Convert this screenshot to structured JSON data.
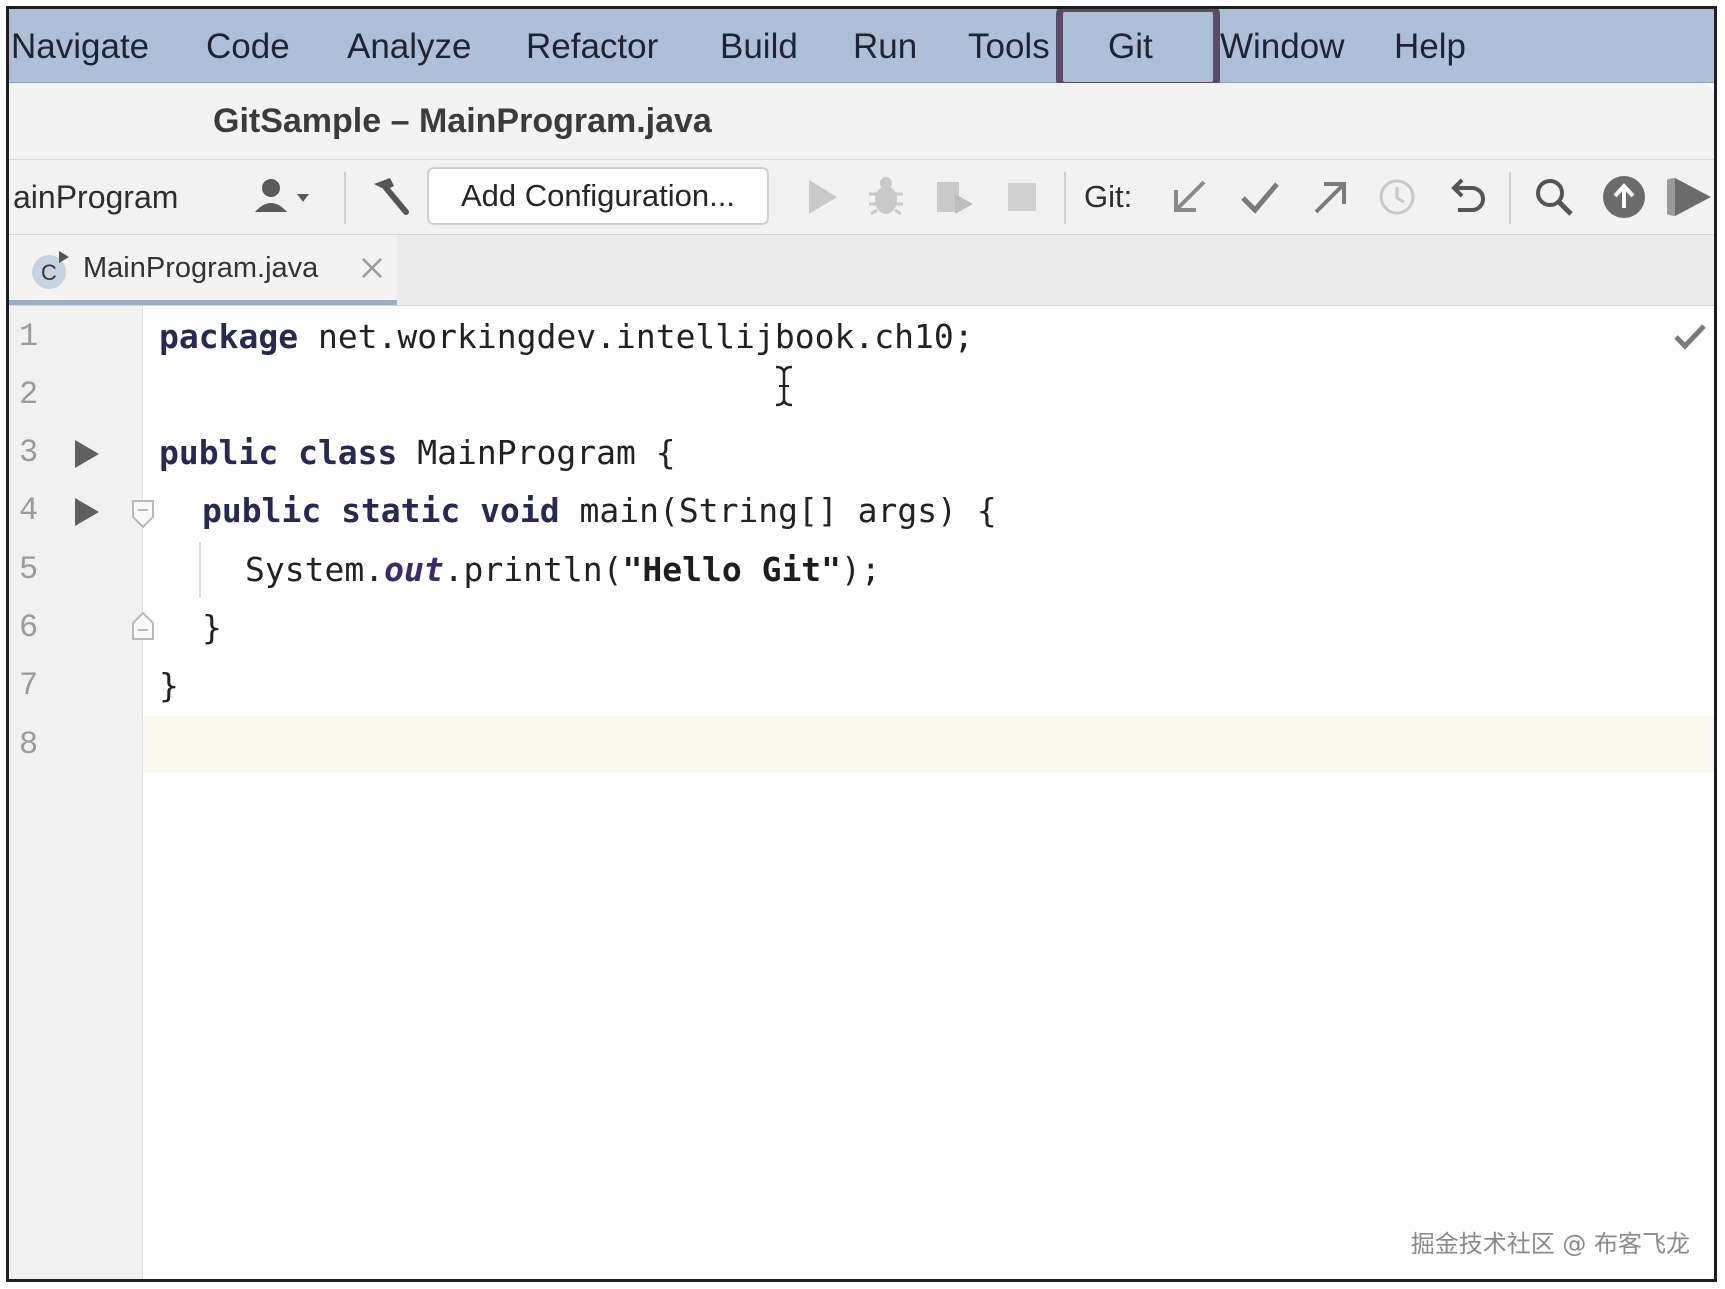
{
  "menu": {
    "items": [
      "Navigate",
      "Code",
      "Analyze",
      "Refactor",
      "Build",
      "Run",
      "Tools",
      "Git",
      "Window",
      "Help"
    ],
    "highlighted": "Git"
  },
  "window": {
    "title": "GitSample – MainProgram.java"
  },
  "toolbar": {
    "run_target": "ainProgram",
    "config_button": "Add Configuration...",
    "git_label": "Git:",
    "icons": [
      "user-icon",
      "hammer-icon",
      "run-icon",
      "debug-icon",
      "coverage-icon",
      "stop-icon",
      "git-update-icon",
      "git-commit-icon",
      "git-push-icon",
      "history-icon",
      "rollback-icon",
      "search-icon",
      "upload-icon",
      "profiler-icon"
    ]
  },
  "tab": {
    "label": "MainProgram.java",
    "icon_letter": "C"
  },
  "editor": {
    "line_numbers": [
      "1",
      "2",
      "3",
      "4",
      "5",
      "6",
      "7",
      "8"
    ],
    "lines": {
      "l1_kw": "package",
      "l1_rest": " net.workingdev.intellijbook.ch10;",
      "l3_kw": "public class",
      "l3_rest": " MainProgram {",
      "l4_kw": "public static void",
      "l4_rest": " main(String[] args) {",
      "l5_a": "System.",
      "l5_field": "out",
      "l5_b": ".println(",
      "l5_str": "\"Hello Git\"",
      "l5_c": ");",
      "l6": "}",
      "l7": "}"
    }
  },
  "watermark": "掘金技术社区 @ 布客飞龙",
  "colors": {
    "menubar": "#aebfd8",
    "highlight": "#5a4c66",
    "keyword": "#262a52",
    "current_line": "#fcfaef"
  }
}
